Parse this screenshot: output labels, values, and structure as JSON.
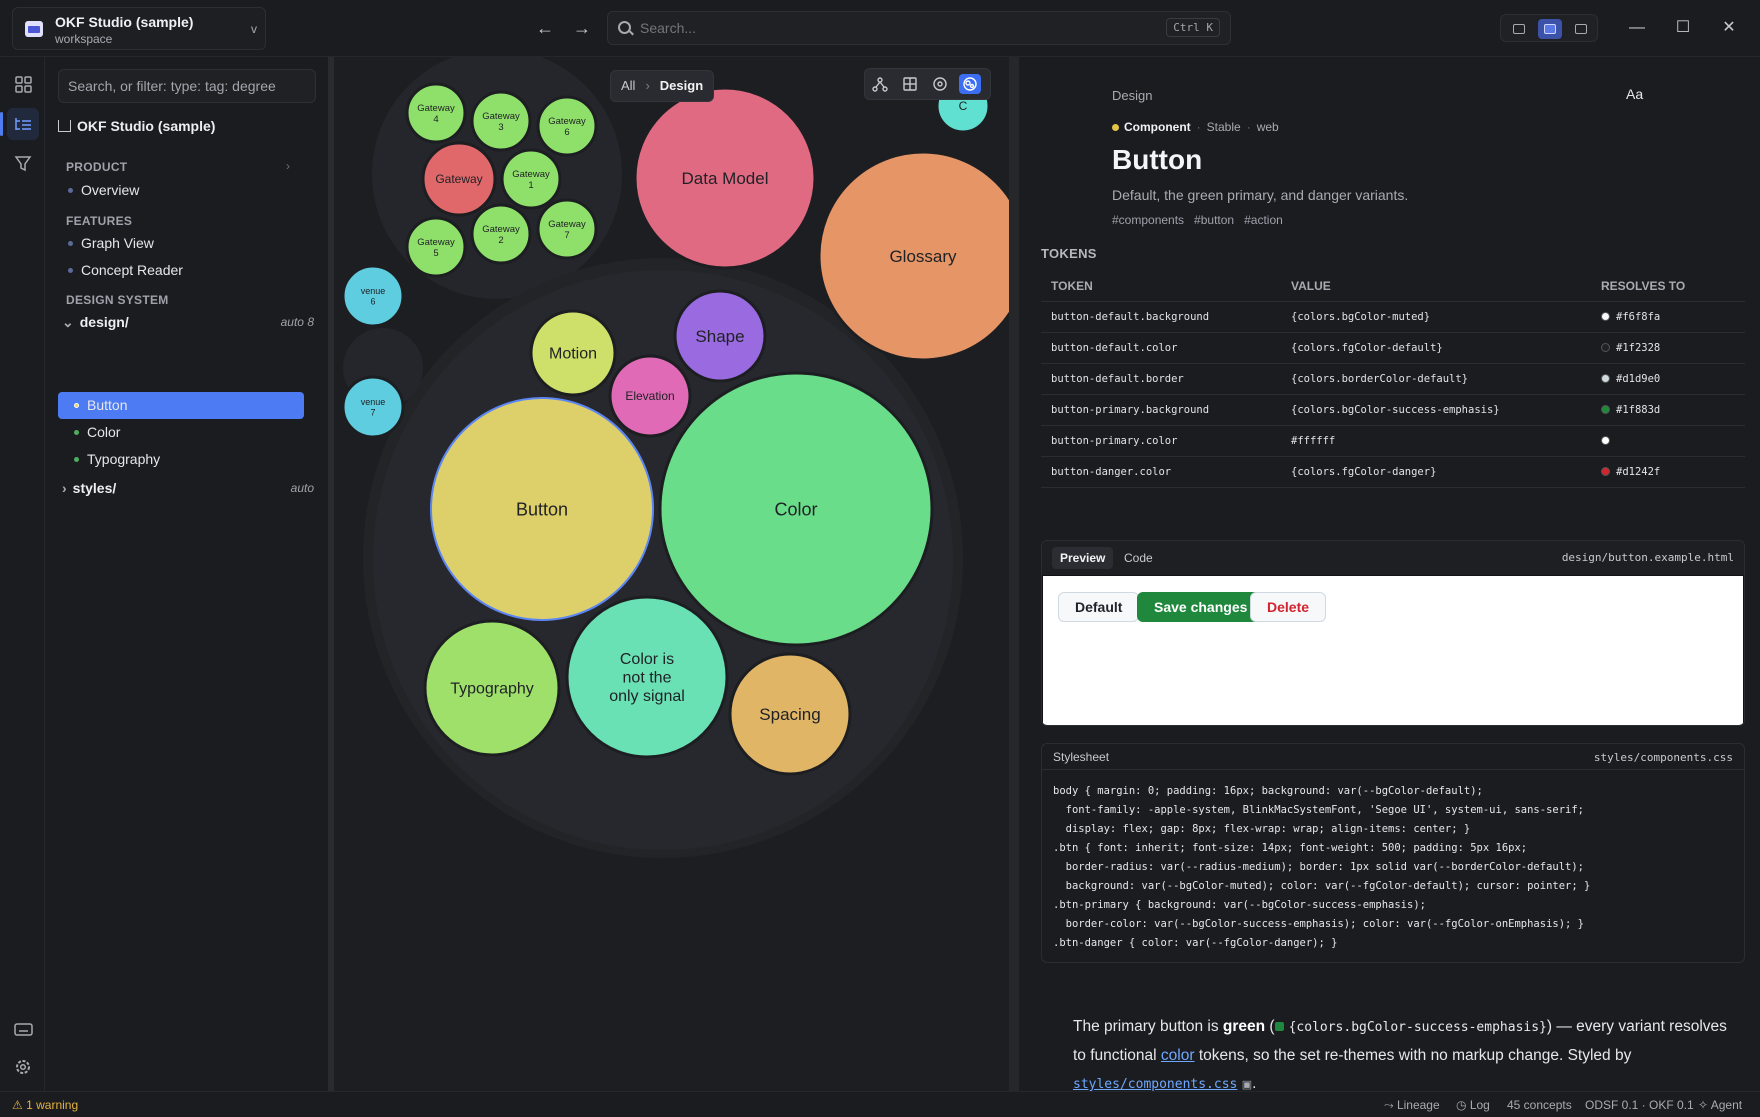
{
  "workspace": {
    "name": "OKF Studio (sample)",
    "subtitle": "workspace",
    "chevron": "v"
  },
  "nav": {
    "back": "←",
    "forward": "→"
  },
  "search": {
    "placeholder": "Search...",
    "shortcut": "Ctrl K"
  },
  "window": {
    "minimize": "—",
    "maximize": "☐",
    "close": "✕"
  },
  "rail": {
    "items": [
      "grid-icon",
      "tree-icon",
      "filter-icon"
    ],
    "bottom": [
      "keyboard-icon",
      "settings-icon"
    ]
  },
  "sidebar": {
    "filter_placeholder": "Search, or filter: type: tag: degree",
    "root": "OKF Studio (sample)",
    "sections": [
      {
        "title": "PRODUCT",
        "items": [
          "Overview"
        ]
      },
      {
        "title": "FEATURES",
        "items": [
          "Graph View",
          "Concept Reader"
        ]
      },
      {
        "title": "DESIGN SYSTEM"
      }
    ],
    "design_folder": {
      "name": "design/",
      "tag": "auto 8",
      "items": [
        "Button",
        "Color",
        "Typography"
      ]
    },
    "styles_folder": {
      "name": "styles/",
      "tag": "auto"
    }
  },
  "canvas": {
    "breadcrumb": {
      "all": "All",
      "current": "Design"
    },
    "bubbles": [
      {
        "label": "Gateway\n4",
        "color": "#8fe06a"
      },
      {
        "label": "Gateway\n3",
        "color": "#8fe06a"
      },
      {
        "label": "Gateway\n6",
        "color": "#8fe06a"
      },
      {
        "label": "Gateway",
        "color": "#e0686a"
      },
      {
        "label": "Gateway\n1",
        "color": "#8fe06a"
      },
      {
        "label": "Gateway\n5",
        "color": "#8fe06a"
      },
      {
        "label": "Gateway\n2",
        "color": "#8fe06a"
      },
      {
        "label": "Gateway\n7",
        "color": "#8fe06a"
      },
      {
        "label": "Data Model",
        "color": "#e06a82"
      },
      {
        "label": "Glossary",
        "color": "#e69566"
      },
      {
        "label": "venue\n6",
        "color": "#5fcde0"
      },
      {
        "label": "venue\n7",
        "color": "#5fcde0"
      },
      {
        "label": "Motion",
        "color": "#cfe06a"
      },
      {
        "label": "Shape",
        "color": "#9a6ae0"
      },
      {
        "label": "Elevation",
        "color": "#e06ab5"
      },
      {
        "label": "Button",
        "color": "#ddd06a"
      },
      {
        "label": "Color",
        "color": "#6add8a"
      },
      {
        "label": "Typography",
        "color": "#9fe06a"
      },
      {
        "label": "Color is\nnot the\nonly signal",
        "color": "#6ae0b5"
      },
      {
        "label": "Spacing",
        "color": "#e0b566"
      },
      {
        "label": "C",
        "color": "#5fe0d0"
      }
    ]
  },
  "detail": {
    "eyebrow": "Design",
    "font_toggle": "Aa",
    "kind": "Component",
    "status": "Stable",
    "platform": "web",
    "title": "Button",
    "description": "Default, the green primary, and danger variants.",
    "tags": [
      "#components",
      "#button",
      "#action"
    ],
    "tokens_label": "TOKENS",
    "token_headers": [
      "TOKEN",
      "VALUE",
      "RESOLVES TO"
    ],
    "tokens": [
      {
        "token": "button-default.background",
        "value": "{colors.bgColor-muted}",
        "resolves": "#f6f8fa"
      },
      {
        "token": "button-default.color",
        "value": "{colors.fgColor-default}",
        "resolves": "#1f2328"
      },
      {
        "token": "button-default.border",
        "value": "{colors.borderColor-default}",
        "resolves": "#d1d9e0"
      },
      {
        "token": "button-primary.background",
        "value": "{colors.bgColor-success-emphasis}",
        "resolves": "#1f883d"
      },
      {
        "token": "button-primary.color",
        "value": "#ffffff",
        "resolves": ""
      },
      {
        "token": "button-danger.color",
        "value": "{colors.fgColor-danger}",
        "resolves": "#d1242f"
      }
    ],
    "token_swatches": [
      "#f6f8fa",
      "#1f2328",
      "#d1d9e0",
      "#1f883d",
      "#ffffff",
      "#d1242f"
    ],
    "preview": {
      "tabs": [
        "Preview",
        "Code"
      ],
      "path": "design/button.example.html",
      "buttons": {
        "default": "Default",
        "primary": "Save changes",
        "danger": "Delete"
      }
    },
    "stylesheet": {
      "label": "Stylesheet",
      "path": "styles/components.css",
      "code": "body { margin: 0; padding: 16px; background: var(--bgColor-default);\n  font-family: -apple-system, BlinkMacSystemFont, 'Segoe UI', system-ui, sans-serif;\n  display: flex; gap: 8px; flex-wrap: wrap; align-items: center; }\n.btn { font: inherit; font-size: 14px; font-weight: 500; padding: 5px 16px;\n  border-radius: var(--radius-medium); border: 1px solid var(--borderColor-default);\n  background: var(--bgColor-muted); color: var(--fgColor-default); cursor: pointer; }\n.btn-primary { background: var(--bgColor-success-emphasis);\n  border-color: var(--bgColor-success-emphasis); color: var(--fgColor-onEmphasis); }\n.btn-danger { color: var(--fgColor-danger); }"
    },
    "paragraph": {
      "p1": "The primary button is ",
      "green": "green",
      "open": " (",
      "chip": "{colors.bgColor-success-emphasis}",
      "p2": ") — every variant resolves to functional ",
      "link": "color",
      "p3": " tokens, so the set re-themes with no markup change. Styled by ",
      "file": "styles/components.css",
      "end": "."
    }
  },
  "status": {
    "warning": "1 warning",
    "lineage": "Lineage",
    "log": "Log",
    "concepts": "45 concepts",
    "version": "ODSF 0.1 · OKF 0.1",
    "agent": "Agent"
  }
}
